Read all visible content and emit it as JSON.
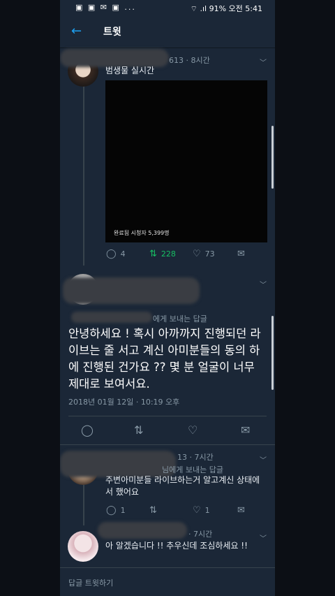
{
  "status": {
    "left_icons": "▣ ▣ ✉ ▣ ...",
    "right": "⌔ .ıl 91% 오전 5:41"
  },
  "header": {
    "back_icon": "←",
    "title": "트윗"
  },
  "tweet1": {
    "meta": "613 · 8시간",
    "name_text": "범생물 실시간",
    "media_caption": "완료됨   시청자 5,399명",
    "replies": "4",
    "retweets": "228",
    "likes": "73"
  },
  "tweet2": {
    "reply_to": "에게 보내는 답글",
    "body": "안녕하세요 ! 혹시 아까까지 진행되던 라이브는 줄 서고 계신 아미분들의 동의 하에 진행된 건가요 ?? 몇 분 얼굴이 너무 제대로 보여서요.",
    "timestamp": "2018년 01월 12일 · 10:19 오후"
  },
  "tweet3": {
    "meta": "13 · 7시간",
    "reply_to": "님에게 보내는 답글",
    "body": "주변아미분들 라이브하는거 알고계신 상태에서 했어요",
    "replies": "1",
    "likes": "1"
  },
  "tweet4": {
    "meta": "· 7시간",
    "body": "아 알겠습니다 !! 추우신데 조심하세요 !!"
  },
  "composer": {
    "placeholder": "답글 트윗하기"
  }
}
